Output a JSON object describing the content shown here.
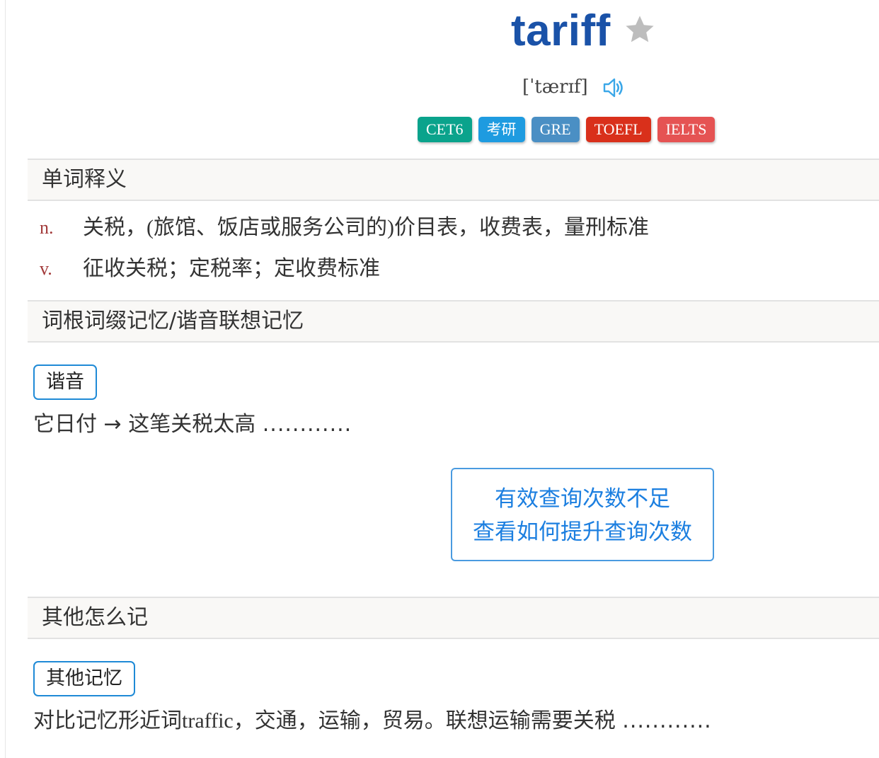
{
  "word": {
    "title": "tariff",
    "phonetic": "[ˈtærɪf]"
  },
  "tags": [
    {
      "label": "CET6",
      "color": "#0aa38c"
    },
    {
      "label": "考研",
      "color": "#1e9be0"
    },
    {
      "label": "GRE",
      "color": "#4a8fc4"
    },
    {
      "label": "TOEFL",
      "color": "#d9301b"
    },
    {
      "label": "IELTS",
      "color": "#e55353"
    }
  ],
  "sections": {
    "definitions": "单词释义",
    "root_memory": "词根词缀记忆/谐音联想记忆",
    "other_memory": "其他怎么记"
  },
  "definitions": [
    {
      "pos": "n.",
      "meaning_pre": "关税，",
      "meaning_latin": "(",
      "meaning_mid": "旅馆、饭店或服务公司的",
      "meaning_latin2": ")",
      "meaning_post": "价目表，收费表，量刑标准"
    },
    {
      "pos": "v.",
      "meaning": "征收关税；定税率；定收费标准"
    }
  ],
  "homophone": {
    "tag": "谐音",
    "text": "它日付 → 这笔关税太高",
    "dots": "............"
  },
  "notice": {
    "line1": "有效查询次数不足",
    "line2": "查看如何提升查询次数"
  },
  "other": {
    "tag": "其他记忆",
    "text_pre": "对比记忆形近词",
    "text_latin": "traffic",
    "text_post": "，交通，运输，贸易。联想运输需要关税",
    "dots": "............"
  },
  "colors": {
    "title": "#1a52a8",
    "pos": "#a23a3a",
    "tag_border": "#1f8ad6",
    "notice": "#1c7fe0",
    "star": "#bdbdbd",
    "audio": "#3ba7e8"
  },
  "icons": {
    "favorite": "star-icon",
    "pronounce": "speaker-icon"
  }
}
